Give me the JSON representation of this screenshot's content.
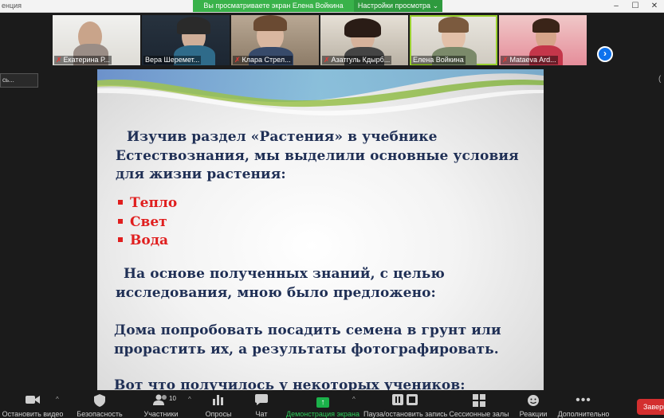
{
  "window": {
    "app_title": "енция"
  },
  "share_banner": {
    "viewing_text": "Вы просматриваете экран Елена Войкина",
    "view_options": "Настройки просмотра"
  },
  "participants": [
    {
      "name": "Екатерина Р...",
      "muted": true
    },
    {
      "name": "Вера Шеремет...",
      "muted": false
    },
    {
      "name": "Клара Стрел...",
      "muted": true
    },
    {
      "name": "Азатгуль Кдырб...",
      "muted": true
    },
    {
      "name": "Елена Войкина",
      "muted": false
    },
    {
      "name": "Mataeva Ard...",
      "muted": true
    }
  ],
  "side": {
    "left_label": "сь..."
  },
  "slide": {
    "intro": [
      "Изучив раздел «Растения» в учебнике",
      "Естествознания, мы выделили основные условия",
      "для жизни растения:"
    ],
    "bullets": [
      "Тепло",
      "Свет",
      "Вода"
    ],
    "para2": [
      "На основе полученных знаний, с целью",
      "исследования, мною было предложено:"
    ],
    "para3": [
      "Дома попробовать посадить семена в грунт или",
      "прорастить их, а результаты фотографировать."
    ],
    "para4": [
      "Вот что получилось у некоторых учеников:"
    ],
    "colors": {
      "text": "#1f2f55",
      "bullet": "#e01e1e"
    }
  },
  "toolbar": {
    "stop_video": "Остановить видео",
    "security": "Безопасность",
    "participants": "Участники",
    "participants_count": "10",
    "polls": "Опросы",
    "chat": "Чат",
    "share_screen": "Демонстрация экрана",
    "pause_recording": "Пауза/остановить запись",
    "breakout_rooms": "Сессионные залы",
    "reactions": "Реакции",
    "more": "Дополнительно",
    "end": "Заверш"
  }
}
